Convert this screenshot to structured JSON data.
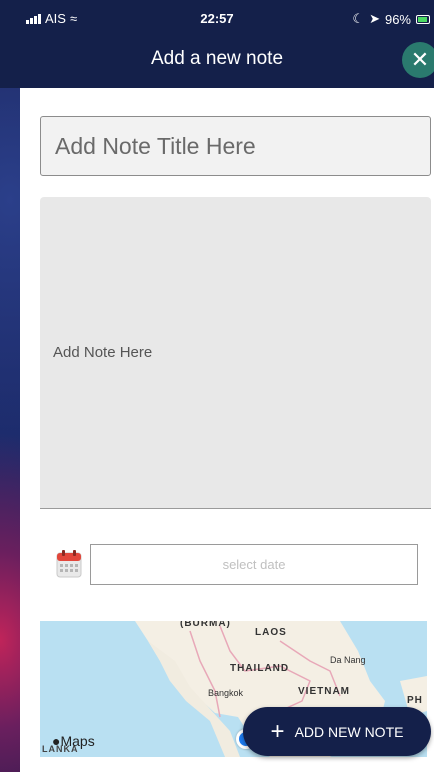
{
  "status_bar": {
    "carrier": "AIS",
    "time": "22:57",
    "battery": "96%"
  },
  "header": {
    "title": "Add a new note",
    "close_icon": "close-icon"
  },
  "form": {
    "title_placeholder": "Add Note Title Here",
    "title_value": "",
    "note_placeholder": "Add Note Here",
    "date_placeholder": "select date",
    "calendar_icon": "calendar-icon"
  },
  "map": {
    "labels": {
      "burma": "(BURMA)",
      "laos": "LAOS",
      "thailand": "THAILAND",
      "vietnam": "VIETNAM",
      "bangkok": "Bangkok",
      "da_nang": "Da Nang",
      "lanka": "LANKA",
      "ph": "PH"
    },
    "attribution": "Maps"
  },
  "actions": {
    "add_button_label": "ADD NEW NOTE"
  },
  "colors": {
    "header_bg": "#14204a",
    "close_bg": "#2a7a6e",
    "map_water": "#b9e0f2",
    "location_dot": "#1e7cf2"
  }
}
